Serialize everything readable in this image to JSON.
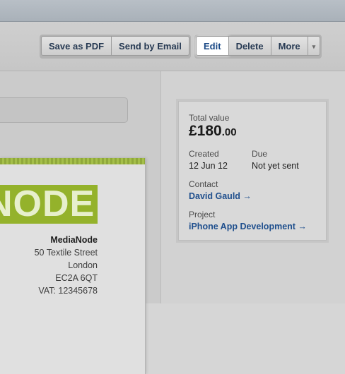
{
  "toolbar": {
    "save_pdf": "Save as PDF",
    "send_email": "Send by Email",
    "edit": "Edit",
    "delete": "Delete",
    "more": "More",
    "more_caret": "▾"
  },
  "invoice": {
    "logo_text": "NODE",
    "company": "MediaNode",
    "address_line1": "50 Textile Street",
    "city": "London",
    "postcode": "EC2A 6QT",
    "vat": "VAT: 12345678"
  },
  "summary": {
    "total_label": "Total value",
    "total_main": "£180",
    "total_cents": ".00",
    "created_label": "Created",
    "created_value": "12 Jun 12",
    "due_label": "Due",
    "due_value": "Not yet sent",
    "contact_label": "Contact",
    "contact_value": "David Gauld →",
    "project_label": "Project",
    "project_value": "iPhone App Development →"
  },
  "colors": {
    "accent_green": "#94b22b",
    "link_blue": "#1f4f8d"
  }
}
